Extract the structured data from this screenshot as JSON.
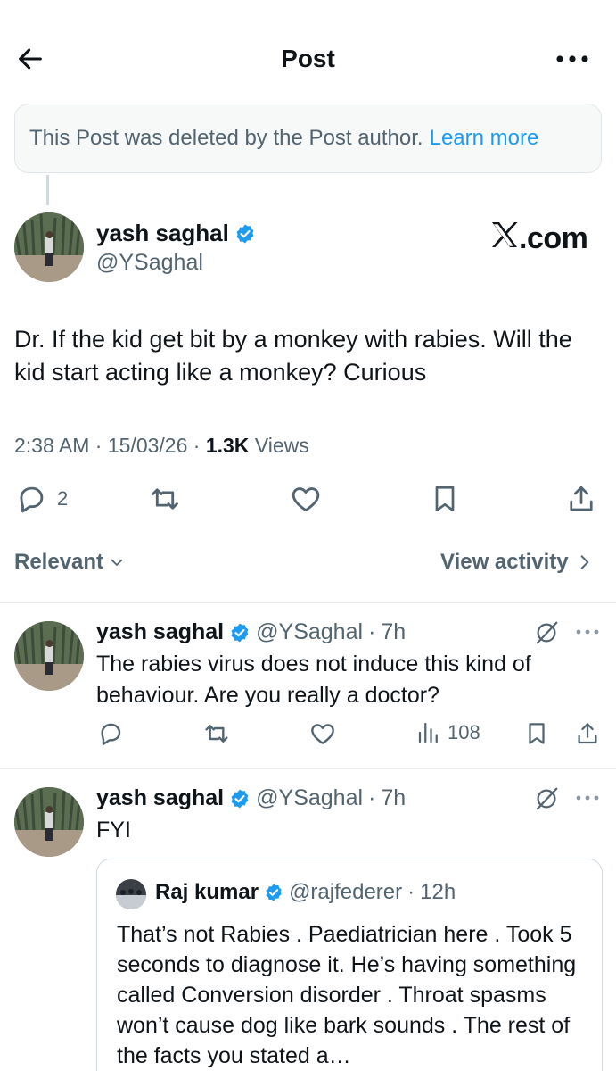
{
  "header": {
    "title": "Post"
  },
  "deleted_banner": {
    "message": "This Post was deleted by the Post author.",
    "link": "Learn more"
  },
  "main_post": {
    "name": "yash saghal",
    "handle": "@YSaghal",
    "watermark": "X.com",
    "text": "Dr. If the kid get bit by a monkey with rabies. Will the kid start acting like a monkey? Curious",
    "time": "2:38 AM",
    "date": "15/03/26",
    "views_count": "1.3K",
    "views_label": "Views",
    "reply_count": "2"
  },
  "filters": {
    "relevant": "Relevant",
    "view_activity": "View activity"
  },
  "replies": [
    {
      "name": "yash saghal",
      "handle": "@YSaghal",
      "age": "7h",
      "text": "The rabies virus does not induce this kind of behaviour. Are you really a doctor?",
      "views": "108"
    },
    {
      "name": "yash saghal",
      "handle": "@YSaghal",
      "age": "7h",
      "text": "FYI",
      "quote": {
        "name": "Raj kumar",
        "handle": "@rajfederer",
        "age": "12h",
        "text": "That’s not Rabies . Paediatrician here . Took 5 seconds to diagnose it. He’s having something called Conversion disorder . Throat spasms won’t cause dog like bark sounds . The rest of the facts you stated a…"
      }
    }
  ],
  "colors": {
    "accent": "#1d9bf0",
    "secondary_text": "#536471",
    "verified": "#1d9bf0"
  }
}
